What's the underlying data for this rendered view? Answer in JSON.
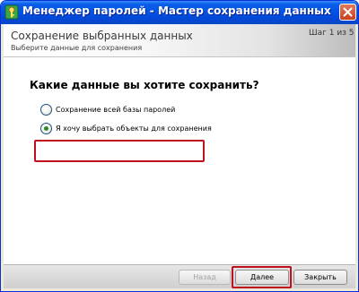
{
  "window": {
    "title": "Менеджер паролей - Мастер сохранения данных"
  },
  "header": {
    "title": "Сохранение выбранных данных",
    "subtitle": "Выберите данные для сохранения",
    "step": "Шаг 1 из 5"
  },
  "main": {
    "question": "Какие данные вы хотите сохранить?",
    "options": [
      {
        "label": "Сохранение всей базы паролей",
        "selected": false
      },
      {
        "label": "Я хочу выбрать объекты для сохранения",
        "selected": true
      }
    ]
  },
  "footer": {
    "back_label": "Назад",
    "next_label": "Далее",
    "close_label": "Закрыть"
  }
}
